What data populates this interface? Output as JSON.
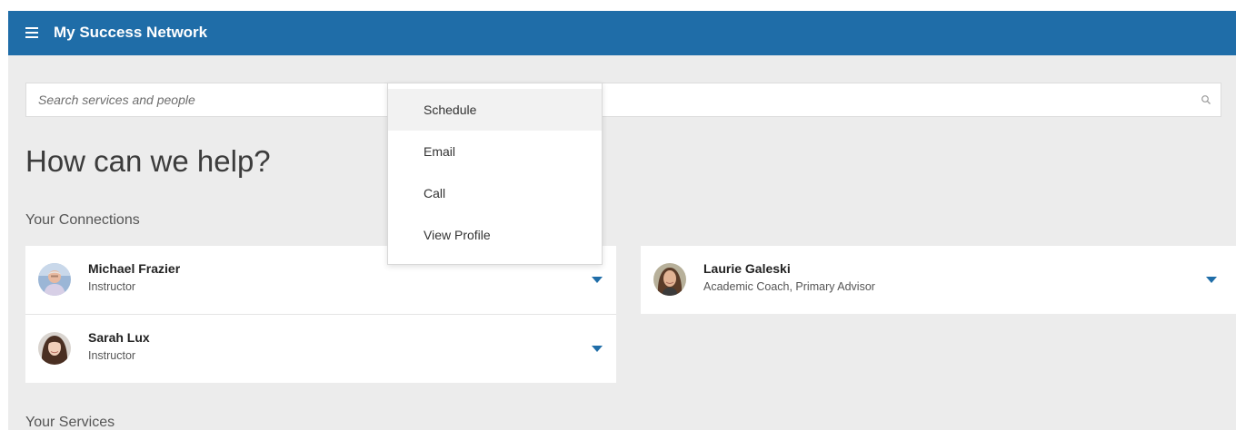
{
  "header": {
    "title": "My Success Network",
    "menu_icon": "hamburger-icon",
    "bar_color": "#1f6da8"
  },
  "search": {
    "placeholder": "Search services and people",
    "icon": "search-icon"
  },
  "headline": "How can we help?",
  "sections": {
    "connections_label": "Your Connections",
    "services_label": "Your Services"
  },
  "connections": [
    {
      "name": "Michael Frazier",
      "role": "Instructor"
    },
    {
      "name": "Laurie Galeski",
      "role": "Academic Coach, Primary Advisor"
    },
    {
      "name": "Sarah Lux",
      "role": "Instructor"
    }
  ],
  "dropdown_menu": {
    "items": [
      {
        "label": "Schedule",
        "hovered": true
      },
      {
        "label": "Email"
      },
      {
        "label": "Call"
      },
      {
        "label": "View Profile"
      }
    ]
  }
}
